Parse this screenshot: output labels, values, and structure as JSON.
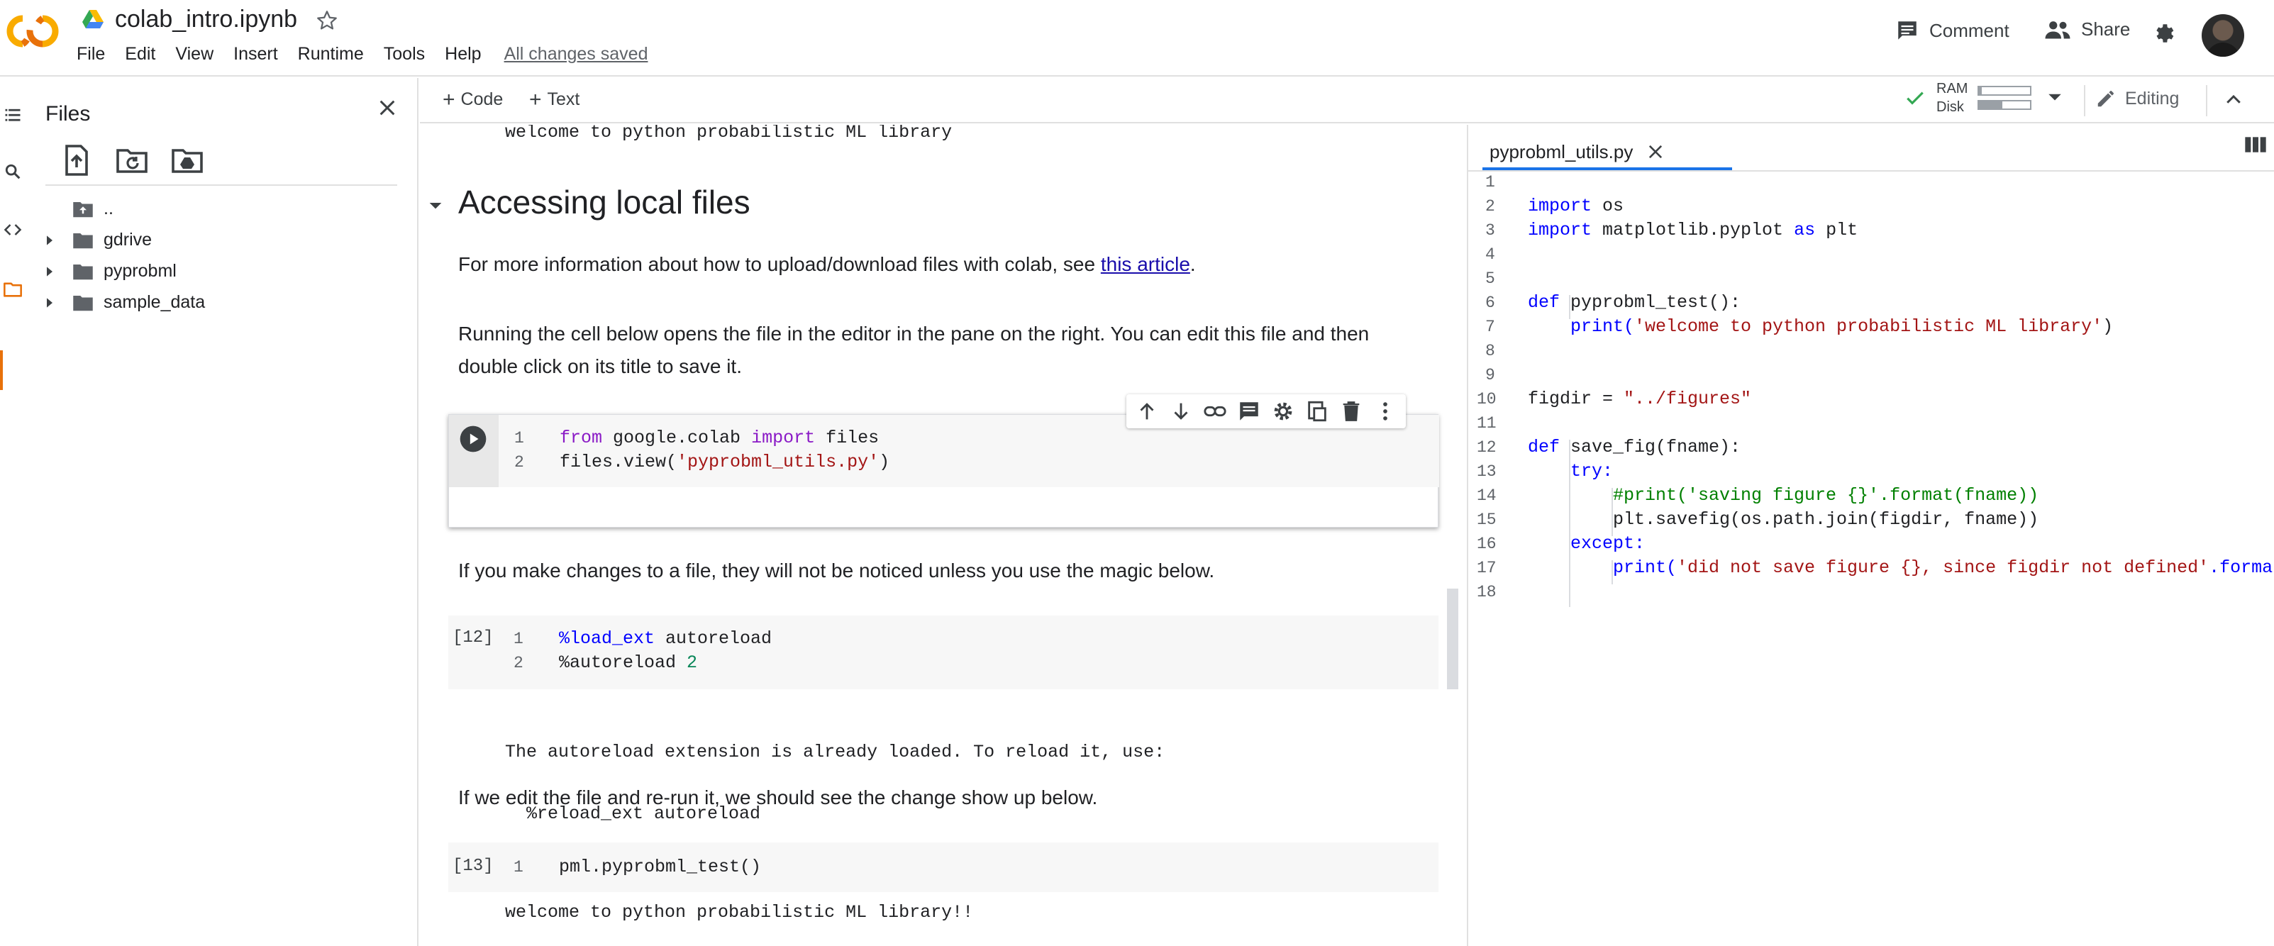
{
  "header": {
    "title": "colab_intro.ipynb",
    "menu": [
      "File",
      "Edit",
      "View",
      "Insert",
      "Runtime",
      "Tools",
      "Help"
    ],
    "saved_status": "All changes saved",
    "comment_label": "Comment",
    "share_label": "Share"
  },
  "files_panel": {
    "title": "Files",
    "tree": [
      {
        "label": ".."
      },
      {
        "label": "gdrive"
      },
      {
        "label": "pyprobml"
      },
      {
        "label": "sample_data"
      }
    ]
  },
  "toolbar": {
    "add_code_label": "Code",
    "add_text_label": "Text",
    "ram_label": "RAM",
    "disk_label": "Disk",
    "ram_usage": 0.05,
    "disk_usage": 0.45,
    "editing_label": "Editing"
  },
  "notebook": {
    "top_output": "welcome to python probabilistic ML library",
    "section_heading": "Accessing local files",
    "para1_prefix": "For more information about how to upload/download files with colab, see ",
    "para1_link": "this article",
    "para1_suffix": ".",
    "para2_line1": "Running the cell below opens the file in the editor in the pane on the right. You can edit this file and then",
    "para2_line2": "double click on its title to save it.",
    "cell1": {
      "lines": [
        {
          "n": "1",
          "t1": "from",
          "t2": " google.colab ",
          "t3": "import",
          "t4": " files"
        },
        {
          "n": "2",
          "t1": "files.view(",
          "t2": "'pyprobml_utils.py'",
          "t3": ")"
        }
      ]
    },
    "para3": "If you make changes to a file, they will not be noticed unless you use the magic below.",
    "cell2": {
      "prompt": "[12]",
      "lines": [
        {
          "n": "1",
          "t1": "%load_ext",
          "t2": " autoreload"
        },
        {
          "n": "2",
          "t1": "%autoreload ",
          "t2": "2"
        }
      ],
      "output_line1": "The autoreload extension is already loaded. To reload it, use:",
      "output_line2": "  %reload_ext autoreload"
    },
    "para4": "If we edit the file and re-run it, we should see the change show up below.",
    "cell3": {
      "prompt": "[13]",
      "line": {
        "n": "1",
        "t": "pml.pyprobml_test()"
      },
      "output": "welcome to python probabilistic ML library!!"
    }
  },
  "editor": {
    "tab_label": "pyprobml_utils.py",
    "line_numbers": [
      "1",
      "2",
      "3",
      "4",
      "5",
      "6",
      "7",
      "8",
      "9",
      "10",
      "11",
      "12",
      "13",
      "14",
      "15",
      "16",
      "17",
      "18"
    ],
    "lines": {
      "l2a": "import",
      "l2b": " os",
      "l3a": "import",
      "l3b": " matplotlib.pyplot ",
      "l3c": "as",
      "l3d": " plt",
      "l6a": "def",
      "l6b": " pyprobml_test():",
      "l7a": "print(",
      "l7b": "'welcome to python probabilistic ML library'",
      "l7c": ")",
      "l10a": "figdir = ",
      "l10b": "\"../figures\"",
      "l12a": "def",
      "l12b": " save_fig(fname):",
      "l13a": "try:",
      "l14a": "#print('saving figure {}'.format(fname))",
      "l15a": "plt.savefig(os.path.join(figdir, fname))",
      "l16a": "except:",
      "l17a": "print(",
      "l17b": "'did not save figure {}, since figdir not defined'",
      "l17c": ".forma"
    }
  },
  "colors": {
    "accent_orange": "#e8710a",
    "link_blue": "#1a0dab",
    "keyword_purple": "#8a1ac6",
    "string_red": "#a31515",
    "number_green": "#098658",
    "keyword_blue": "#0000ff",
    "tab_underline": "#1a73e8"
  },
  "icons": [
    "colab-logo",
    "drive-icon",
    "star-icon",
    "comment-icon",
    "share-icon",
    "gear-icon",
    "avatar",
    "toc-icon",
    "search-icon",
    "code-icon",
    "folder-icon",
    "close-icon",
    "upload-icon",
    "refresh-folder-icon",
    "drive-mount-icon",
    "parent-folder-icon",
    "caret-right-icon",
    "plus-icon",
    "check-icon",
    "chevron-down-icon",
    "pencil-icon",
    "chevron-up-icon",
    "run-icon",
    "arrow-up-icon",
    "arrow-down-icon",
    "link-icon",
    "comment-cell-icon",
    "settings-cell-icon",
    "mirror-cell-icon",
    "delete-icon",
    "more-vert-icon",
    "split-view-icon"
  ]
}
